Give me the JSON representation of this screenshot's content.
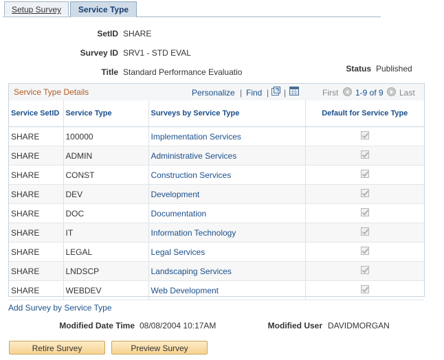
{
  "tabs": [
    {
      "label": "Setup Survey",
      "active": false
    },
    {
      "label": "Service Type",
      "active": true
    }
  ],
  "fields": {
    "setid_label": "SetID",
    "setid_value": "SHARE",
    "survey_id_label": "Survey ID",
    "survey_id_value": "SRV1 - STD EVAL",
    "title_label": "Title",
    "title_value": "Standard Performance Evaluatio",
    "status_label": "Status",
    "status_value": "Published"
  },
  "grid": {
    "title": "Service Type Details",
    "personalize": "Personalize",
    "find": "Find",
    "sep": "|",
    "first": "First",
    "range": "1-9 of 9",
    "last": "Last",
    "columns": [
      "Service SetID",
      "Service Type",
      "Surveys by Service Type",
      "Default for Service Type"
    ],
    "rows": [
      {
        "setid": "SHARE",
        "type": "100000",
        "survey": "Implementation Services",
        "default": true
      },
      {
        "setid": "SHARE",
        "type": "ADMIN",
        "survey": "Administrative Services",
        "default": true
      },
      {
        "setid": "SHARE",
        "type": "CONST",
        "survey": "Construction Services",
        "default": true
      },
      {
        "setid": "SHARE",
        "type": "DEV",
        "survey": "Development",
        "default": true
      },
      {
        "setid": "SHARE",
        "type": "DOC",
        "survey": "Documentation",
        "default": true
      },
      {
        "setid": "SHARE",
        "type": "IT",
        "survey": "Information Technology",
        "default": true
      },
      {
        "setid": "SHARE",
        "type": "LEGAL",
        "survey": "Legal Services",
        "default": true
      },
      {
        "setid": "SHARE",
        "type": "LNDSCP",
        "survey": "Landscaping Services",
        "default": true
      },
      {
        "setid": "SHARE",
        "type": "WEBDEV",
        "survey": "Web Development",
        "default": true
      }
    ]
  },
  "add_link": "Add Survey by Service Type",
  "footer": {
    "modified_date_label": "Modified Date Time",
    "modified_date_value": "08/08/2004 10:17AM",
    "modified_user_label": "Modified User",
    "modified_user_value": "DAVIDMORGAN"
  },
  "buttons": {
    "retire": "Retire Survey",
    "preview": "Preview Survey"
  },
  "colors": {
    "link": "#1a4f8b",
    "grid_title": "#b55a1d",
    "button_bg": "#f6d391"
  }
}
